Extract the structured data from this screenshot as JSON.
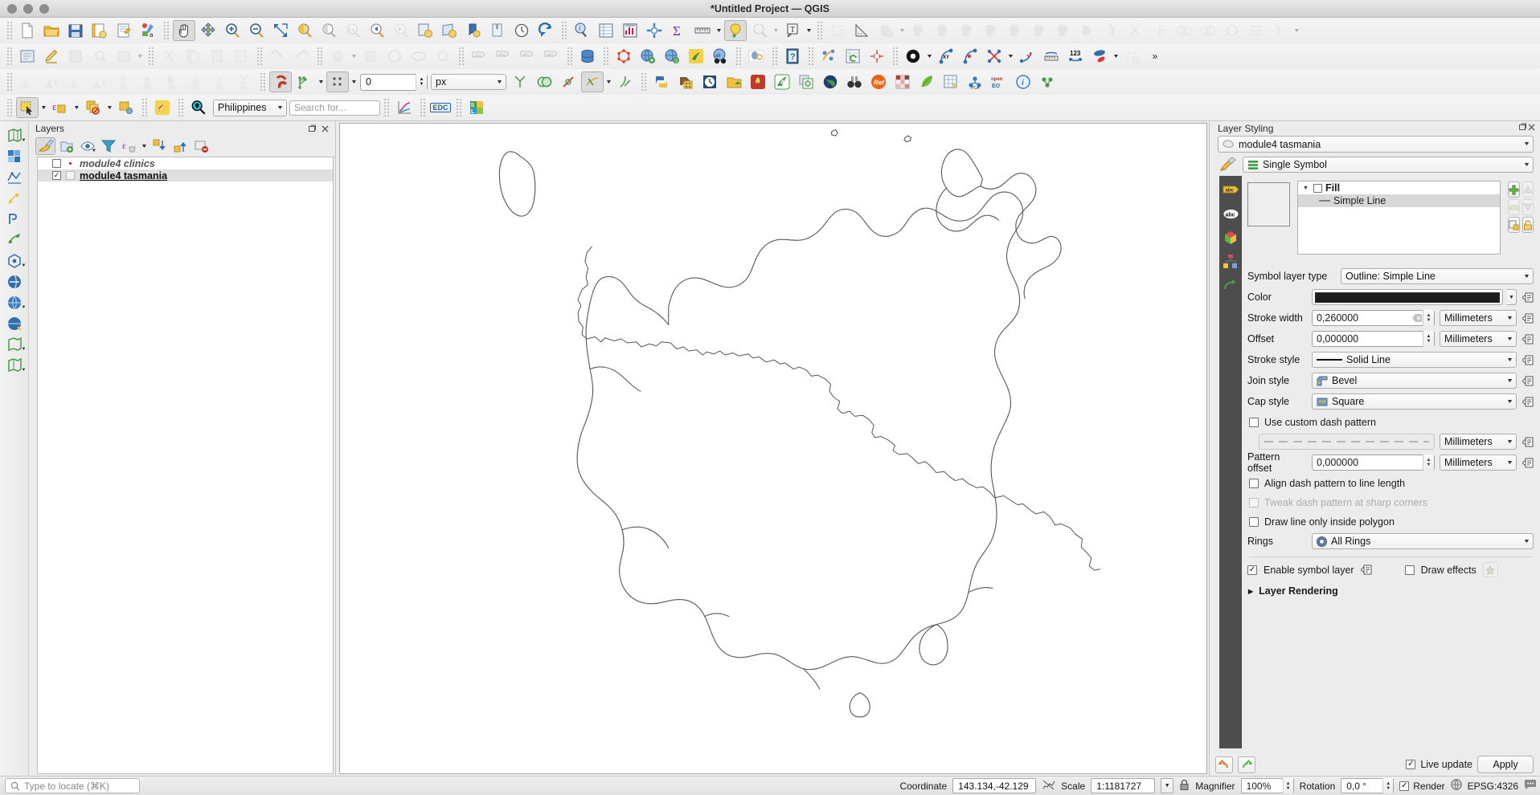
{
  "window": {
    "title": "*Untitled Project — QGIS"
  },
  "toolbars": {
    "row1": [
      {
        "name": "new-project-icon",
        "label": "New Project"
      },
      {
        "name": "open-project-icon",
        "label": "Open Project"
      },
      {
        "name": "save-project-icon",
        "label": "Save Project"
      },
      {
        "name": "save-project-as-icon",
        "label": "Save Project As"
      },
      {
        "name": "new-print-layout-icon",
        "label": "New Print Layout"
      },
      {
        "name": "style-manager-icon",
        "label": "Style Manager"
      },
      {
        "name": "pan-map-icon",
        "label": "Pan Map"
      },
      {
        "name": "pan-to-selection-icon",
        "label": "Pan Map to Selection"
      },
      {
        "name": "zoom-in-icon",
        "label": "Zoom In"
      },
      {
        "name": "zoom-out-icon",
        "label": "Zoom Out"
      },
      {
        "name": "zoom-full-icon",
        "label": "Zoom Full"
      },
      {
        "name": "zoom-selection-icon",
        "label": "Zoom to Selection"
      },
      {
        "name": "zoom-layer-icon",
        "label": "Zoom to Layer"
      },
      {
        "name": "zoom-native-icon",
        "label": "Zoom to Native Resolution"
      },
      {
        "name": "zoom-last-icon",
        "label": "Zoom Last"
      },
      {
        "name": "zoom-next-icon",
        "label": "Zoom Next"
      },
      {
        "name": "refresh-map-icon",
        "label": "Refresh"
      },
      {
        "name": "identify-features-icon",
        "label": "Identify Features"
      },
      {
        "name": "attribute-table-icon",
        "label": "Open Attribute Table"
      },
      {
        "name": "statistics-icon",
        "label": "Statistical Summary"
      },
      {
        "name": "processing-toolbox-icon",
        "label": "Processing Toolbox"
      },
      {
        "name": "sum-icon",
        "label": "Field Calculator"
      },
      {
        "name": "measure-line-icon",
        "label": "Measure Line"
      },
      {
        "name": "map-tips-icon",
        "label": "Show Map Tips"
      },
      {
        "name": "annotation-icon",
        "label": "Annotations"
      },
      {
        "name": "text-annotation-icon",
        "label": "Text Annotation"
      }
    ],
    "row2": [
      {
        "name": "current-edits-icon",
        "label": "Current Edits"
      },
      {
        "name": "toggle-editing-icon",
        "label": "Toggle Editing"
      },
      {
        "name": "save-layer-edits-icon",
        "label": "Save Layer Edits"
      },
      {
        "name": "vertex-tool-icon",
        "label": "Vertex Tool"
      },
      {
        "name": "modify-attributes-icon",
        "label": "Modify Attributes of Features"
      },
      {
        "name": "cut-features-icon",
        "label": "Cut Features"
      },
      {
        "name": "copy-features-icon",
        "label": "Copy Features"
      },
      {
        "name": "paste-features-icon",
        "label": "Paste Features"
      },
      {
        "name": "undo-icon",
        "label": "Undo"
      },
      {
        "name": "redo-icon",
        "label": "Redo"
      },
      {
        "name": "add-point-feature-icon",
        "label": "Add Point Feature"
      },
      {
        "name": "digitize-shape-icon",
        "label": "Digitize Shape"
      },
      {
        "name": "add-circle-icon",
        "label": "Add Circle"
      },
      {
        "name": "add-polygon-icon",
        "label": "Add Polygon"
      },
      {
        "name": "label-icon",
        "label": "Label Tools"
      },
      {
        "name": "pin-labels-icon",
        "label": "Pin Labels"
      },
      {
        "name": "show-hide-labels-icon",
        "label": "Show/Hide Labels"
      },
      {
        "name": "move-label-icon",
        "label": "Move Label"
      },
      {
        "name": "database-icon",
        "label": "DB Manager"
      },
      {
        "name": "topology-icon",
        "label": "Topology Checker"
      },
      {
        "name": "add-web-layer-icon",
        "label": "Add Web Layer"
      },
      {
        "name": "metasearch-icon",
        "label": "MetaSearch"
      },
      {
        "name": "plugin-icon",
        "label": "Plugins"
      },
      {
        "name": "osm-binoculars-icon",
        "label": "OSM Place Search"
      },
      {
        "name": "cloud-icon",
        "label": "QGIS Cloud"
      },
      {
        "name": "help-icon",
        "label": "Help"
      },
      {
        "name": "georeferencer-icon",
        "label": "Georeferencer"
      },
      {
        "name": "refresh-table-icon",
        "label": "Refresh Table"
      },
      {
        "name": "crosshair-icon",
        "label": "Crosshair"
      }
    ],
    "row3": {
      "snapping_value": "0",
      "snapping_units": "px",
      "items": [
        {
          "name": "histogram-icon",
          "label": "Raster Histogram"
        },
        {
          "name": "raster-stats-icon",
          "label": "Raster Statistics"
        },
        {
          "name": "brightness-icon",
          "label": "Brightness"
        },
        {
          "name": "contrast-icon",
          "label": "Contrast"
        },
        {
          "name": "saturation-icon",
          "label": "Saturation"
        },
        {
          "name": "gamma-icon",
          "label": "Gamma"
        },
        {
          "name": "snapping-magnet-icon",
          "label": "Enable Snapping"
        },
        {
          "name": "snapping-mode-icon",
          "label": "Snapping Mode"
        },
        {
          "name": "topological-editing-icon",
          "label": "Topological Editing"
        },
        {
          "name": "avoid-overlap-icon",
          "label": "Avoid Overlap"
        },
        {
          "name": "delete-vertex-icon",
          "label": "Delete Vertex"
        },
        {
          "name": "tracing-icon",
          "label": "Enable Tracing"
        },
        {
          "name": "python-console-icon",
          "label": "Python Console"
        },
        {
          "name": "raster-calc-icon",
          "label": "Raster Calculator"
        },
        {
          "name": "timemanager-icon",
          "label": "Temporal Controller"
        },
        {
          "name": "open-data-icon",
          "label": "Open Data File"
        },
        {
          "name": "heatmap-icon",
          "label": "Heatmap"
        },
        {
          "name": "qgis2web-icon",
          "label": "qgis2web"
        },
        {
          "name": "layer-copy-icon",
          "label": "Duplicate Layer"
        },
        {
          "name": "globe-icon",
          "label": "Globe"
        },
        {
          "name": "binoculars-icon",
          "label": "Search"
        },
        {
          "name": "ref-icon",
          "label": "Ref"
        },
        {
          "name": "matrix-icon",
          "label": "Matrix"
        },
        {
          "name": "leaf-icon",
          "label": "Leaf Plugin"
        },
        {
          "name": "grid-icon",
          "label": "Grid"
        },
        {
          "name": "pca-icon",
          "label": "PCA"
        },
        {
          "name": "openeo-icon",
          "label": "openEO"
        },
        {
          "name": "info-icon",
          "label": "Info"
        },
        {
          "name": "cluster-icon",
          "label": "Cluster"
        }
      ]
    },
    "row4": {
      "place_selector": "Philippines",
      "search_placeholder": "Search for...",
      "edc_label": "EDC",
      "items": [
        {
          "name": "select-features-icon",
          "label": "Select Features"
        },
        {
          "name": "select-by-expression-icon",
          "label": "Select by Expression"
        },
        {
          "name": "deselect-features-icon",
          "label": "Deselect Features"
        },
        {
          "name": "select-by-location-icon",
          "label": "Select by Location"
        },
        {
          "name": "measure-area-icon",
          "label": "Measure Area"
        },
        {
          "name": "snake-icon",
          "label": "Snake Plugin"
        },
        {
          "name": "nominatim-search-icon",
          "label": "Place Search"
        },
        {
          "name": "plot-icon",
          "label": "Data Plotly"
        },
        {
          "name": "edc-browser-icon",
          "label": "EDC Browser"
        },
        {
          "name": "semi-auto-classification-icon",
          "label": "Semi-Automatic Classification"
        }
      ]
    },
    "row5": {
      "numeric_label": "123",
      "items": [
        {
          "name": "black-circle-icon",
          "label": "Vertex Symbol"
        },
        {
          "name": "xy-node-icon",
          "label": "XY Tool"
        },
        {
          "name": "node-edit-icon",
          "label": "Node Edit"
        },
        {
          "name": "intersect-icon",
          "label": "Intersection"
        },
        {
          "name": "offset-curve-icon",
          "label": "Offset Curve"
        },
        {
          "name": "measure-ruler-icon",
          "label": "Measure"
        },
        {
          "name": "numeric-vertex-icon",
          "label": "Numeric Vertex Edit"
        },
        {
          "name": "shape-tool-icon",
          "label": "Shape Tool"
        },
        {
          "name": "sort-az-icon",
          "label": "Sort"
        },
        {
          "name": "overflow-icon",
          "label": "More Tools"
        }
      ]
    }
  },
  "left_toolbar": [
    {
      "name": "add-vector-layer-icon",
      "label": "Add Vector Layer"
    },
    {
      "name": "add-raster-layer-icon",
      "label": "Add Raster Layer"
    },
    {
      "name": "add-mesh-layer-icon",
      "label": "Add Mesh Layer"
    },
    {
      "name": "add-delimited-text-layer-icon",
      "label": "Add Delimited Text Layer"
    },
    {
      "name": "add-postgis-layer-icon",
      "label": "Add PostGIS Layer"
    },
    {
      "name": "add-spatialite-layer-icon",
      "label": "Add SpatiaLite Layer"
    },
    {
      "name": "add-mssql-layer-icon",
      "label": "Add MSSQL Layer"
    },
    {
      "name": "add-oracle-layer-icon",
      "label": "Add Oracle Layer"
    },
    {
      "name": "add-wms-layer-icon",
      "label": "Add WMS/WMTS Layer"
    },
    {
      "name": "add-wcs-layer-icon",
      "label": "Add WCS Layer"
    },
    {
      "name": "add-wfs-layer-icon",
      "label": "Add WFS Layer"
    },
    {
      "name": "new-shapefile-layer-icon",
      "label": "New Shapefile Layer"
    }
  ],
  "layers_panel": {
    "title": "Layers",
    "toolbar": [
      {
        "name": "open-layer-styling-panel-icon",
        "label": "Open Layer Styling Panel"
      },
      {
        "name": "add-group-icon",
        "label": "Add Group"
      },
      {
        "name": "manage-map-themes-icon",
        "label": "Manage Map Themes"
      },
      {
        "name": "filter-legend-icon",
        "label": "Filter Legend"
      },
      {
        "name": "expression-filter-icon",
        "label": "Filter Legend by Expression"
      },
      {
        "name": "expand-all-icon",
        "label": "Expand All"
      },
      {
        "name": "collapse-all-icon",
        "label": "Collapse All"
      },
      {
        "name": "remove-layer-icon",
        "label": "Remove Layer/Group"
      }
    ],
    "items": [
      {
        "name": "module4 clinics",
        "checked": false,
        "style": "italic",
        "symbol": "point"
      },
      {
        "name": "module4 tasmania",
        "checked": true,
        "style": "bold",
        "symbol": "polygon"
      }
    ]
  },
  "layer_styling": {
    "title": "Layer Styling",
    "layer_name": "module4 tasmania",
    "renderer": "Single Symbol",
    "vertical_tabs": [
      {
        "name": "labels-tab",
        "label": "Labels"
      },
      {
        "name": "masks-tab",
        "label": "Masks"
      },
      {
        "name": "3d-view-tab",
        "label": "3D View"
      },
      {
        "name": "diagrams-tab",
        "label": "Diagrams"
      },
      {
        "name": "history-tab",
        "label": "History"
      }
    ],
    "symbol_tree": [
      {
        "label": "Fill",
        "level": 0,
        "selected": false,
        "checked": false
      },
      {
        "label": "Simple Line",
        "level": 1,
        "selected": true
      }
    ],
    "tree_buttons": [
      {
        "name": "add-symbol-layer-button",
        "enabled": true
      },
      {
        "name": "move-up-button",
        "enabled": false
      },
      {
        "name": "remove-symbol-layer-button",
        "enabled": false
      },
      {
        "name": "move-down-button",
        "enabled": false
      },
      {
        "name": "duplicate-symbol-layer-button",
        "enabled": true
      },
      {
        "name": "lock-layer-colors-button",
        "enabled": true
      }
    ],
    "symbol_layer_type_label": "Symbol layer type",
    "symbol_layer_type_value": "Outline: Simple Line",
    "properties": {
      "color_label": "Color",
      "color_value": "#1c1c1c",
      "stroke_width_label": "Stroke width",
      "stroke_width_value": "0,260000",
      "stroke_width_unit": "Millimeters",
      "offset_label": "Offset",
      "offset_value": "0,000000",
      "offset_unit": "Millimeters",
      "stroke_style_label": "Stroke style",
      "stroke_style_value": "Solid Line",
      "join_style_label": "Join style",
      "join_style_value": "Bevel",
      "cap_style_label": "Cap style",
      "cap_style_value": "Square",
      "use_custom_dash_label": "Use custom dash pattern",
      "use_custom_dash_checked": false,
      "dash_unit": "Millimeters",
      "pattern_offset_label": "Pattern offset",
      "pattern_offset_value": "0,000000",
      "pattern_offset_unit": "Millimeters",
      "align_dash_label": "Align dash pattern to line length",
      "align_dash_checked": false,
      "tweak_dash_label": "Tweak dash pattern at sharp corners",
      "tweak_dash_checked": false,
      "tweak_dash_enabled": false,
      "draw_inside_label": "Draw line only inside polygon",
      "draw_inside_checked": false,
      "rings_label": "Rings",
      "rings_value": "All Rings"
    },
    "enable_symbol_layer_label": "Enable symbol layer",
    "enable_symbol_layer_checked": true,
    "draw_effects_label": "Draw effects",
    "draw_effects_checked": false,
    "layer_rendering_label": "Layer Rendering",
    "live_update_label": "Live update",
    "live_update_checked": true,
    "apply_label": "Apply",
    "footer_buttons": [
      {
        "name": "undo-style-button",
        "label": "Undo"
      },
      {
        "name": "redo-style-button",
        "label": "Redo"
      }
    ]
  },
  "status_bar": {
    "locate_placeholder": "Type to locate (⌘K)",
    "coordinate_label": "Coordinate",
    "coordinate_value": "143.134,-42.129",
    "scale_label": "Scale",
    "scale_value": "1:1181727",
    "magnifier_label": "Magnifier",
    "magnifier_value": "100%",
    "rotation_label": "Rotation",
    "rotation_value": "0,0 °",
    "render_label": "Render",
    "render_checked": true,
    "crs_label": "EPSG:4326"
  },
  "map": {
    "layer_displayed": "module4 tasmania",
    "outline_color": "#555555"
  }
}
